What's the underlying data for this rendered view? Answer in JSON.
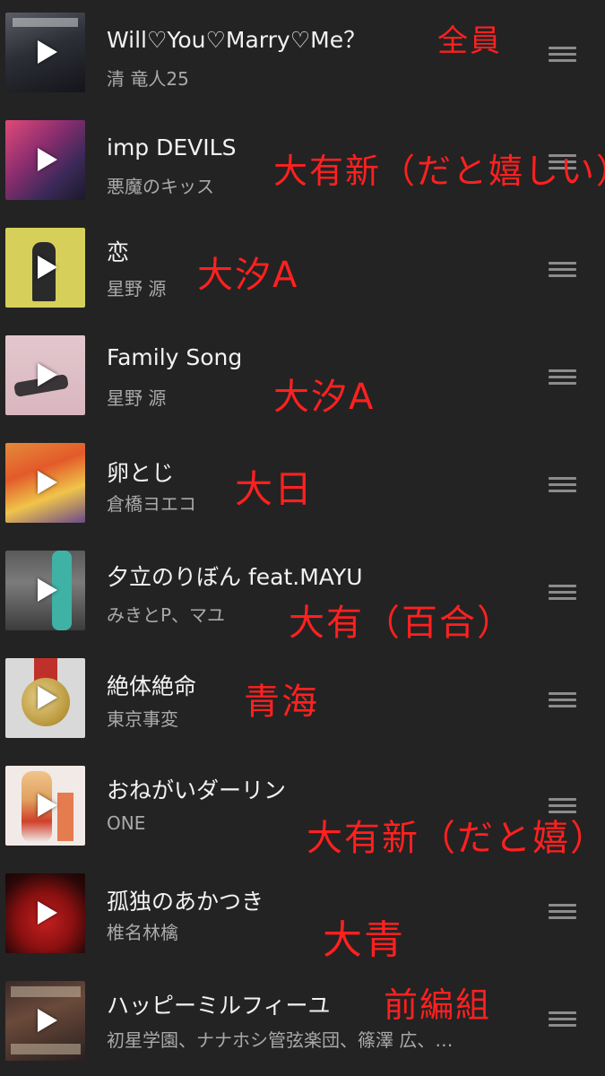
{
  "tracks": [
    {
      "title": "Will♡You♡Marry♡Me？",
      "artist": "清 竜人25",
      "note": "全員",
      "art": "album-art-propose"
    },
    {
      "title": "imp DEVILS",
      "artist": "悪魔のキッス",
      "note": "大有新（だと嬉しい）",
      "art": "album-art-imp-devils"
    },
    {
      "title": "恋",
      "artist": "星野 源",
      "note": "大汐A",
      "art": "album-art-koi"
    },
    {
      "title": "Family Song",
      "artist": "星野 源",
      "note": "大汐A",
      "art": "album-art-family-song"
    },
    {
      "title": "卵とじ",
      "artist": "倉橋ヨエコ",
      "note": "大日",
      "art": "album-art-tamagotoji"
    },
    {
      "title": "夕立のりぼん feat.MAYU",
      "artist": "みきとP、マユ",
      "note": "大有（百合）",
      "art": "album-art-yuudachi"
    },
    {
      "title": "絶体絶命",
      "artist": "東京事変",
      "note": "青海",
      "art": "album-art-zettai-zetsumei"
    },
    {
      "title": "おねがいダーリン",
      "artist": "ONE",
      "note": "大有新（だと嬉）",
      "art": "album-art-onegai-darling"
    },
    {
      "title": "孤独のあかつき",
      "artist": "椎名林檎",
      "note": "大青",
      "art": "album-art-kodoku"
    },
    {
      "title": "ハッピーミルフィーユ",
      "artist": "初星学園、ナナホシ管弦楽団、篠澤 広、…",
      "note": "前編組",
      "art": "album-art-happy-millefeuille"
    }
  ],
  "icons": {
    "play": "play-icon",
    "handle": "drag-handle-icon"
  },
  "colors": {
    "background": "#232323",
    "title": "#f2f2f2",
    "artist": "#a9a9a9",
    "handwriting": "#ff2020"
  }
}
